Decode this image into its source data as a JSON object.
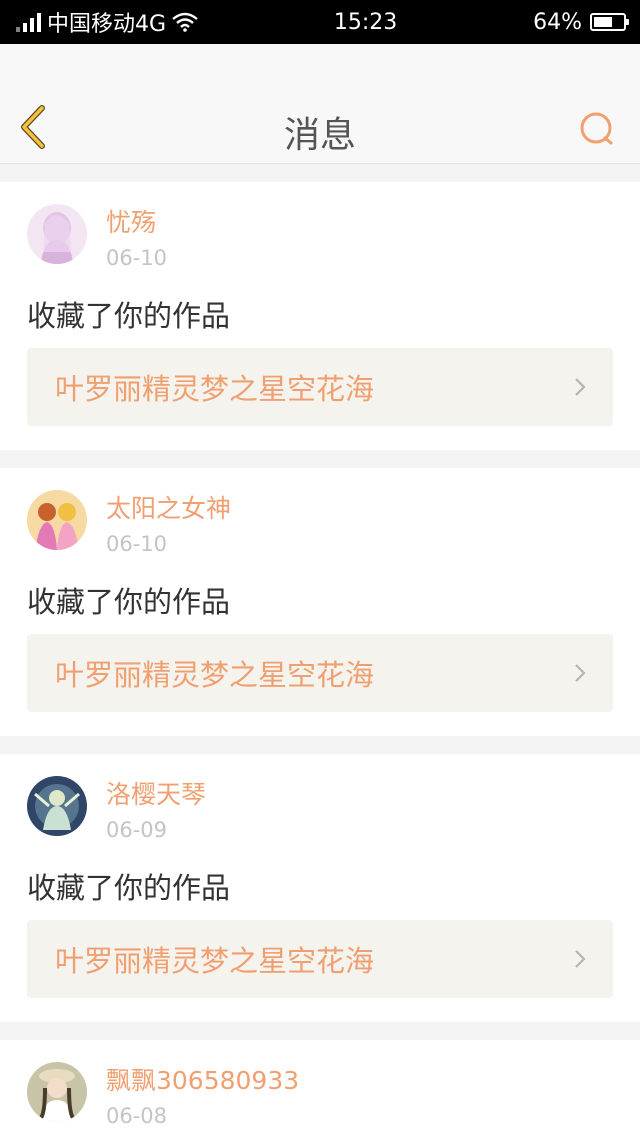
{
  "status_bar": {
    "carrier": "中国移动4G",
    "time": "15:23",
    "battery": "64%",
    "battery_level": 0.64
  },
  "nav": {
    "title": "消息",
    "back_icon": "chevron-left-icon",
    "search_icon": "search-icon"
  },
  "colors": {
    "accent": "#f0a070",
    "back_icon": "#f5c03a",
    "link_bg": "#f4f3ee"
  },
  "messages": [
    {
      "username": "忧殇",
      "date": "06-10",
      "action": "收藏了你的作品",
      "work_title": "叶罗丽精灵梦之星空花海"
    },
    {
      "username": "太阳之女神",
      "date": "06-10",
      "action": "收藏了你的作品",
      "work_title": "叶罗丽精灵梦之星空花海"
    },
    {
      "username": "洛樱天琴",
      "date": "06-09",
      "action": "收藏了你的作品",
      "work_title": "叶罗丽精灵梦之星空花海"
    },
    {
      "username": "飘飘306580933",
      "date": "06-08"
    }
  ]
}
